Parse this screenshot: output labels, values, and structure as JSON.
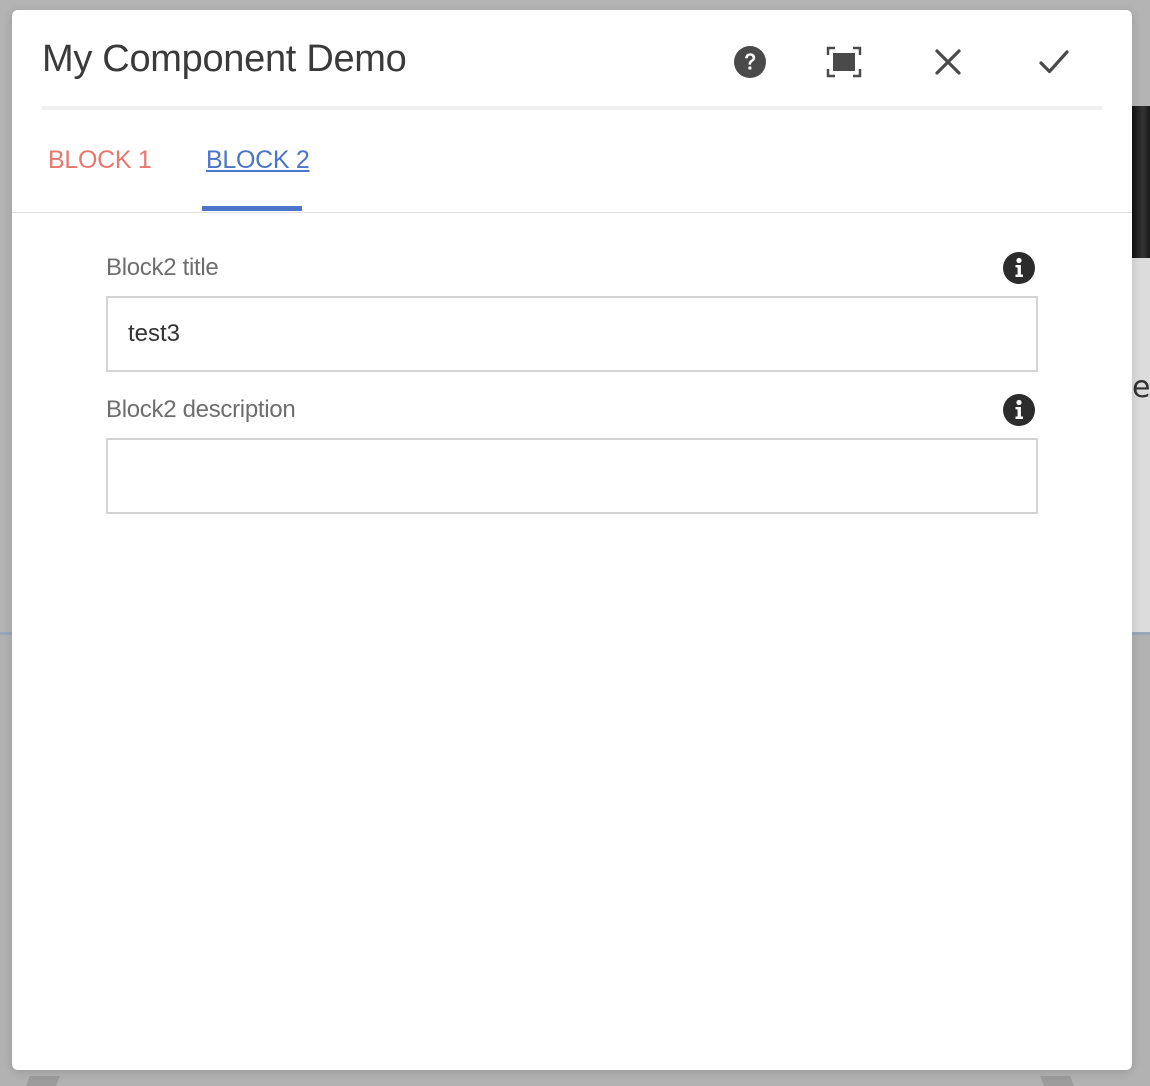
{
  "dialog": {
    "title": "My Component Demo",
    "actions": {
      "help_icon": "help-circle-icon",
      "fullscreen_icon": "fullscreen-icon",
      "close_icon": "close-icon",
      "done_icon": "checkmark-icon"
    }
  },
  "tabs": [
    {
      "label": "BLOCK 1",
      "active": false
    },
    {
      "label": "BLOCK 2",
      "active": true
    }
  ],
  "fields": [
    {
      "label": "Block2 title",
      "value": "test3",
      "placeholder": ""
    },
    {
      "label": "Block2 description",
      "value": "",
      "placeholder": ""
    }
  ],
  "background": {
    "peek_text": "ea"
  },
  "colors": {
    "tab_inactive": "#e8776f",
    "tab_active": "#4b75c8",
    "icon": "#4a4a4a"
  }
}
